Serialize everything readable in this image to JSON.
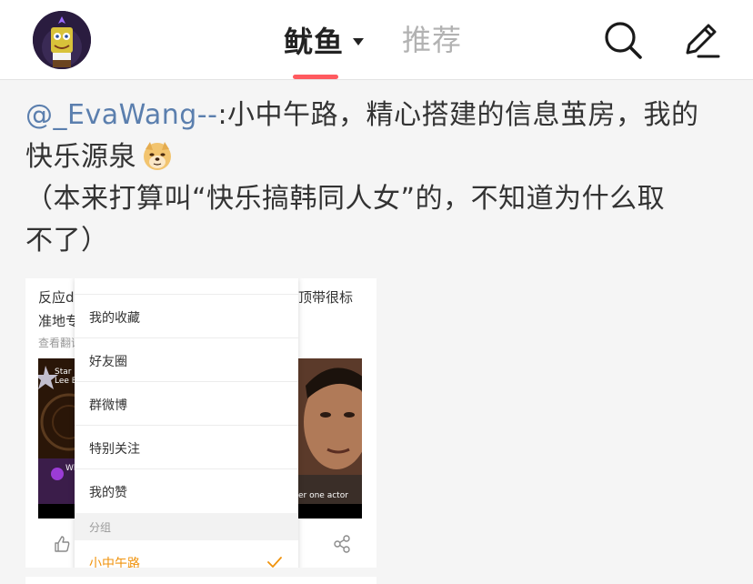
{
  "header": {
    "active_tab": "鱿鱼",
    "second_tab": "推荐",
    "accent_color": "#ff5a5f"
  },
  "post": {
    "mention": "@_EvaWang--",
    "text_line1": ":小中午路，精心搭建的信息茧房，我的",
    "text_line2": "快乐源泉",
    "text_line3": "（本来打算叫“快乐搞韩同人女”的，不知道为什么取",
    "text_line4": "不了）",
    "emoji": "doge-icon"
  },
  "screenshot": {
    "left_text_1": "反应d",
    "left_text_2": "准地专",
    "left_link": "查看翻译",
    "right_text": "顶带很标",
    "video_left_caption_1": "Star De",
    "video_left_caption_2": "Lee Be",
    "video_left_caption_3": "Wh",
    "video_right_caption": "er one actor",
    "dropdown": {
      "items": [
        "我的收藏",
        "好友圈",
        "群微博",
        "特别关注",
        "我的赞"
      ],
      "section_label": "分组",
      "selected_item": "小中午路",
      "selected_color": "#f0930d"
    }
  }
}
